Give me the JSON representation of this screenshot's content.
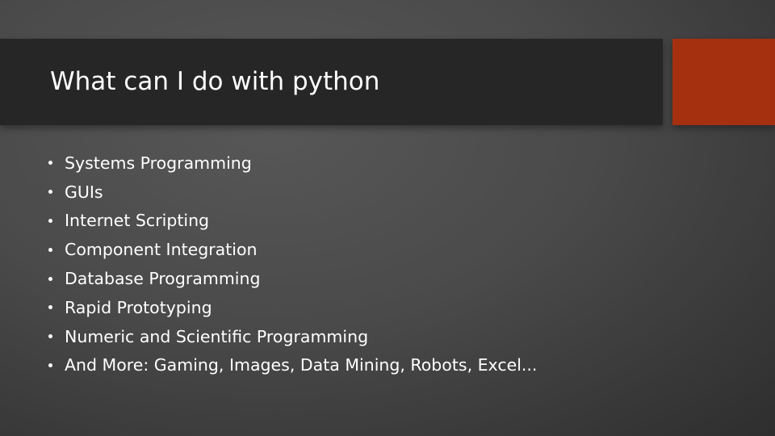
{
  "slide": {
    "title": "What can I do with python",
    "accent_color": "#a5300f",
    "bullets": [
      "Systems Programming",
      "GUIs",
      "Internet Scripting",
      "Component Integration",
      "Database Programming",
      "Rapid Prototyping",
      "Numeric and Scientific Programming",
      "And More: Gaming, Images, Data Mining, Robots, Excel..."
    ]
  }
}
